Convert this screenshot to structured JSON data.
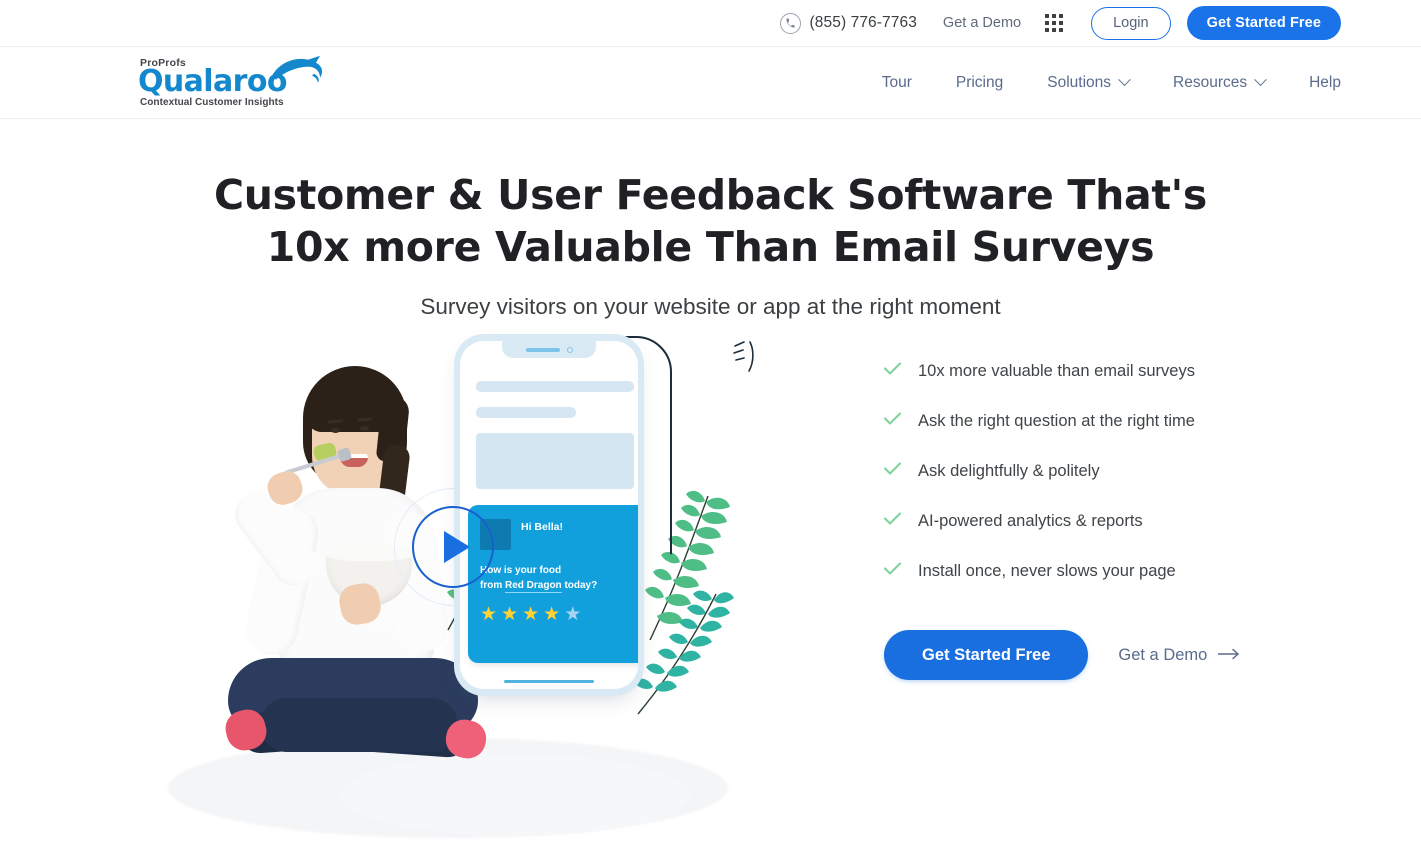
{
  "topbar": {
    "phone_icon": "phone-icon",
    "phone_number": "(855) 776-7763",
    "demo_link": "Get a Demo",
    "apps_icon": "apps-grid-icon",
    "login_label": "Login",
    "cta_label": "Get Started Free"
  },
  "logo": {
    "brand_top": "ProProfs",
    "brand_main": "Qualaroo",
    "tagline": "Contextual Customer Insights"
  },
  "nav": {
    "items": [
      {
        "label": "Tour",
        "has_caret": false
      },
      {
        "label": "Pricing",
        "has_caret": false
      },
      {
        "label": "Solutions",
        "has_caret": true
      },
      {
        "label": "Resources",
        "has_caret": true
      },
      {
        "label": "Help",
        "has_caret": false
      }
    ]
  },
  "hero": {
    "title_line1": "Customer & User Feedback Software That's",
    "title_line2": "10x more Valuable Than Email Surveys",
    "subtitle": "Survey visitors on your website or app at the right moment"
  },
  "features": {
    "items": [
      "10x more valuable than email surveys",
      "Ask the right question at the right time",
      "Ask delightfully & politely",
      "AI-powered analytics & reports",
      "Install once, never slows your page"
    ],
    "cta_primary": "Get Started Free",
    "cta_secondary": "Get a Demo"
  },
  "illustration": {
    "play_button": "play-video-button",
    "survey_widget": {
      "greeting": "Hi Bella!",
      "question_line1": "How is your food",
      "question_pre": "from ",
      "question_brand": "Red Dragon",
      "question_post": " today?",
      "rating_filled": 4,
      "rating_total": 5
    }
  },
  "colors": {
    "brand_blue": "#1a73e8",
    "logo_blue": "#1488cc",
    "nav_text": "#5a6b8c",
    "check_green": "#7ed49a",
    "widget_blue": "#12a0dd",
    "star_gold": "#ffd233"
  }
}
